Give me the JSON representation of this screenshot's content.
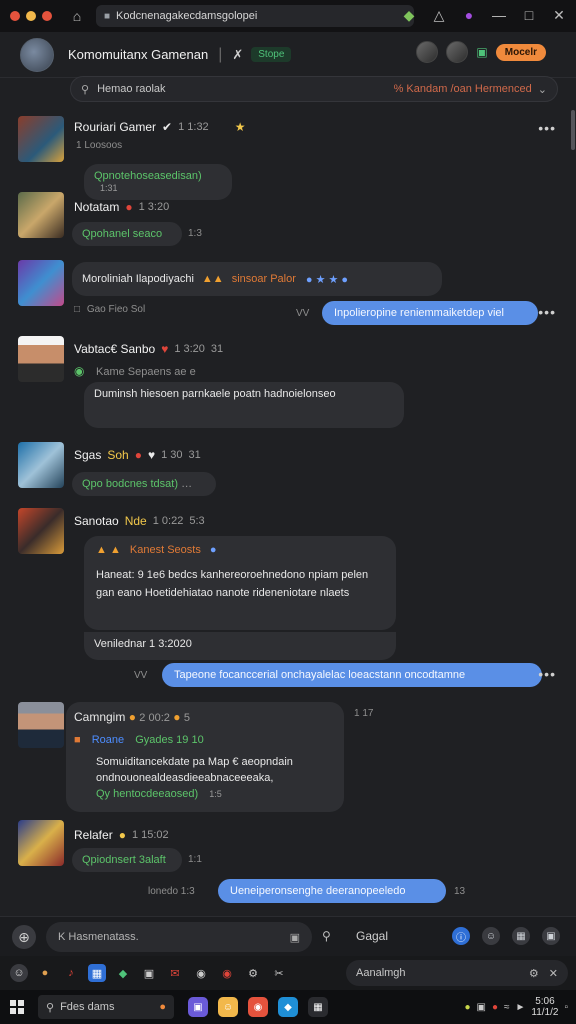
{
  "browser": {
    "url": "Kodcnenagakecdamsgolopei",
    "dot_colors": [
      "#e5533d",
      "#f2b84b",
      "#e5533d"
    ]
  },
  "channel": {
    "title": "Komomuitanx Gamenan",
    "tag": "Stope",
    "badge": "Mocelr"
  },
  "search": {
    "placeholder": "Hemao raolak",
    "right_text": "% Kandam /oan  Hermenced"
  },
  "messages": [
    {
      "name": "Rouriari Gamer",
      "time": "1 1:32",
      "sub": "1 Loosoos",
      "bubble": "Qpnotehoseasedisan)",
      "bubble_time": "1:31"
    },
    {
      "name": "Notatam",
      "time": "1 3:20",
      "sub": "",
      "bubble": "Qpohanel seaco",
      "bubble_time": "1:3"
    },
    {
      "name": "",
      "time": "",
      "sub": "Gao Fieo Sol",
      "bubble": "Moroliniah Ilapodiyachi",
      "bubble_accent": "sinsoar Palor",
      "bubble_time": ""
    }
  ],
  "outgoing_1": {
    "label": "VV",
    "text": "Inpolieropine reniemmaiketdep viel"
  },
  "msg4": {
    "name": "Vabtac€ Sanbo",
    "time": "1 3:20",
    "time2": "31",
    "accent": "Kame  Sepaens  ae  e",
    "body": "Duminsh hiesoen parnkaele poatn hadnoielonseo"
  },
  "msg5": {
    "name": "Sgas",
    "name2": "Soh",
    "time": "1 30",
    "time2": "31",
    "bubble": "Qpo bodcnes tdsat)"
  },
  "msg6": {
    "name": "Sanotao",
    "name_accent": "Nde",
    "time": "1 0:22",
    "time2": "5:3",
    "accent": "Kanest  Seosts",
    "body": "Haneat: 9 1e6 bedcs kanhereoroehnedono npiam pelen gan eano Hoetidehiatao nanote rideneniotare nlaets",
    "footer": "Venilednar 1 3:2020"
  },
  "outgoing_2": {
    "label": "VV",
    "text": "Tapeone focanccerial onchayalelac loeacstann oncodtamne"
  },
  "msg7": {
    "name": "Camngim",
    "time": "2 00:2",
    "time2": "5",
    "side_time": "1 17",
    "accent_blue": "Roane",
    "accent_green": "Gyades  19  10",
    "body": "Somuiditancekdate pa Map € aeopndain ondnouonealdeasdieeabnaceeeaka,",
    "green_line": "Qy hentocdeeaosed)",
    "green_time": "1:5"
  },
  "msg8": {
    "name": "Relafer",
    "time": "1 15:02",
    "bubble": "Qpiodnsert 3alaft",
    "bubble_time": "1:1"
  },
  "outgoing_3": {
    "label": "lonedo 1:3",
    "text": "Ueneiperonsenghe deeranopeeledo",
    "time": "13"
  },
  "composer": {
    "placeholder": "K  Hasmenatass.",
    "send_label": "Gagal"
  },
  "toolbar": {
    "search_text": "Aanalmgh"
  },
  "taskbar": {
    "search_text": "Fdes dams",
    "tray_time": "5:06",
    "tray_date": "11/1/2"
  }
}
